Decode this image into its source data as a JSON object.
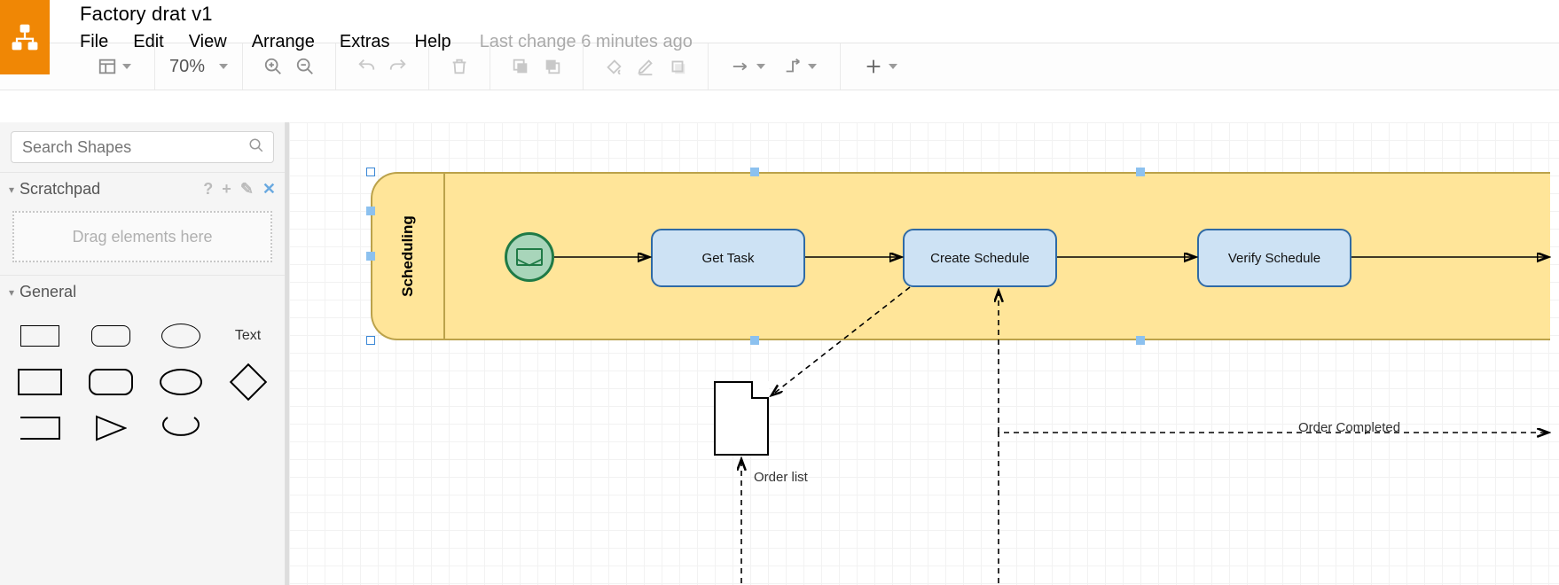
{
  "header": {
    "doc_title": "Factory drat v1",
    "menus": [
      "File",
      "Edit",
      "View",
      "Arrange",
      "Extras",
      "Help"
    ],
    "last_change": "Last change 6 minutes ago"
  },
  "toolbar": {
    "zoom": "70%",
    "buttons": {
      "view_panels": "toggle-panels",
      "zoom_in": "zoom-in",
      "zoom_out": "zoom-out",
      "undo": "undo",
      "redo": "redo",
      "delete": "delete",
      "to_front": "to-front",
      "to_back": "to-back",
      "fill": "fill-color",
      "line": "line-color",
      "shadow": "shadow",
      "connection": "connection",
      "waypoints": "waypoints",
      "add": "add-shape"
    }
  },
  "sidebar": {
    "search_placeholder": "Search Shapes",
    "scratchpad": {
      "title": "Scratchpad",
      "drop_hint": "Drag elements here"
    },
    "general": {
      "title": "General",
      "shapes": [
        "rectangle",
        "rounded-rectangle",
        "ellipse",
        "text",
        "rectangle-bold",
        "rounded-rectangle-bold",
        "ellipse-bold",
        "diamond",
        "rect-half",
        "triangle",
        "oval-half"
      ],
      "text_label": "Text"
    }
  },
  "diagram": {
    "pool_label": "Scheduling",
    "tasks": {
      "t1": "Get Task",
      "t2": "Create Schedule",
      "t3": "Verify Schedule"
    },
    "document_label": "Order list",
    "message_label": "Order Completed",
    "start_event": "message-start"
  }
}
